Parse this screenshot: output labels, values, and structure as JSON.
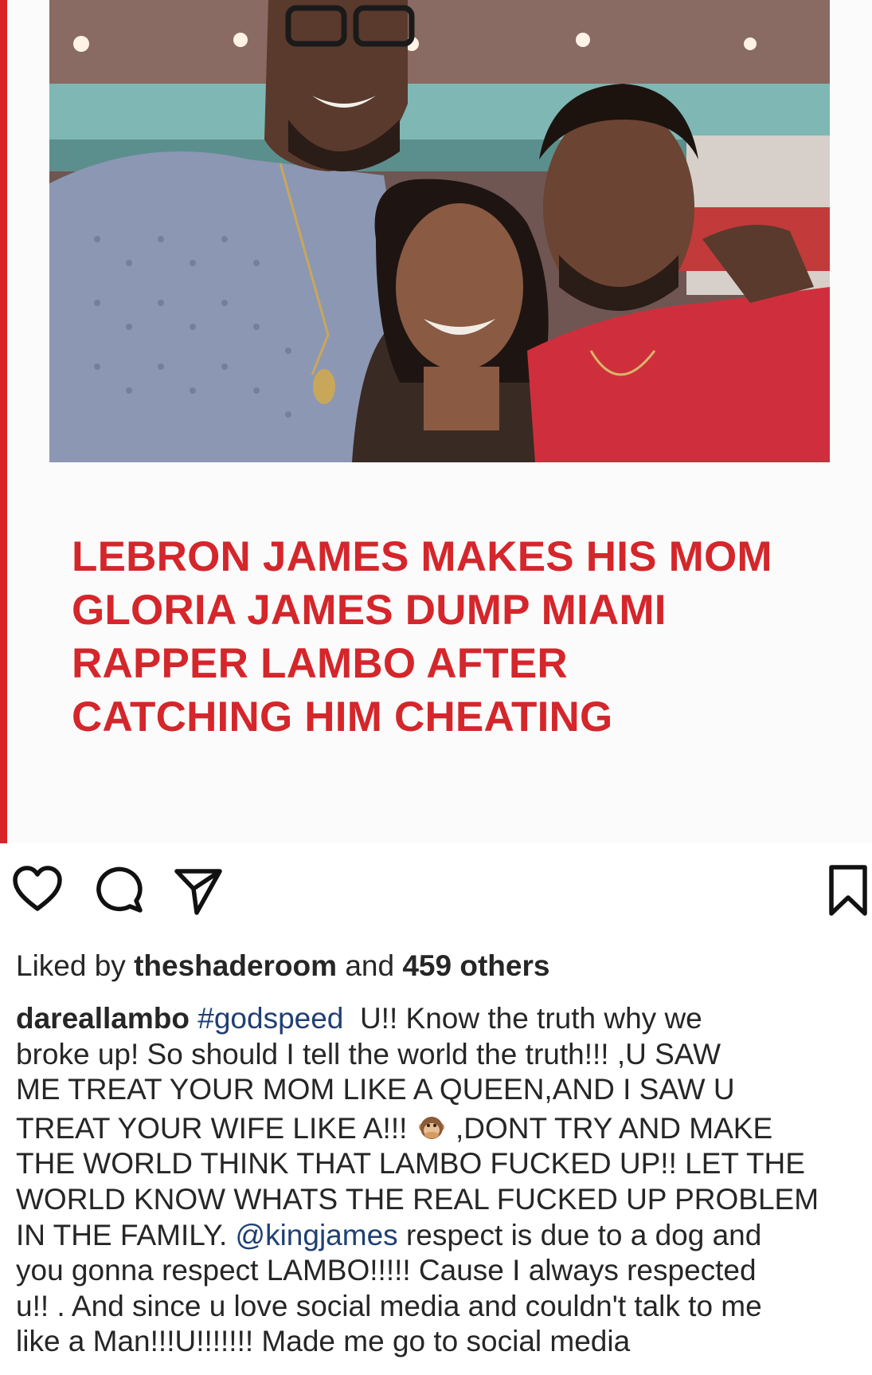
{
  "post": {
    "headline_lines": [
      "LEBRON JAMES MAKES HIS MOM",
      "GLORIA JAMES DUMP MIAMI",
      "RAPPER LAMBO AFTER",
      "CATCHING HIM CHEATING"
    ]
  },
  "actions": {
    "icons": [
      "heart-icon",
      "comment-icon",
      "share-icon",
      "bookmark-icon"
    ]
  },
  "likes": {
    "prefix": "Liked by",
    "user": "theshaderoom",
    "middle": "and",
    "count_text": "459 others"
  },
  "caption": {
    "username": "dareallambo",
    "hashtag": "#godspeed",
    "line1_rest": "  U!! Know the truth why we",
    "line2": "broke up! So should I tell the world the truth!!! ,U SAW",
    "line3": "ME TREAT YOUR MOM LIKE A QUEEN,AND I SAW U",
    "line4_before_emoji": "TREAT YOUR WIFE LIKE A!!! ",
    "line4_after_emoji": " ,DONT TRY AND MAKE",
    "line5": "THE WORLD THINK THAT LAMBO FUCKED UP!! LET THE",
    "line6": "WORLD KNOW WHATS THE REAL FUCKED UP PROBLEM",
    "line7_before_mention": "IN THE FAMILY. ",
    "mention": "@kingjames",
    "line7_after_mention": " respect is due to a dog and",
    "line8": "you gonna respect LAMBO!!!!! Cause I always respected",
    "line9": "u!! . And since u love social media and couldn't talk to me",
    "line10": "like a Man!!!U!!!!!!! Made me go to social media",
    "emoji": "speak-no-evil-monkey"
  },
  "colors": {
    "headline": "#d4262b",
    "accent_edge": "#d9252a",
    "link": "#1f3f74",
    "text": "#262626"
  }
}
